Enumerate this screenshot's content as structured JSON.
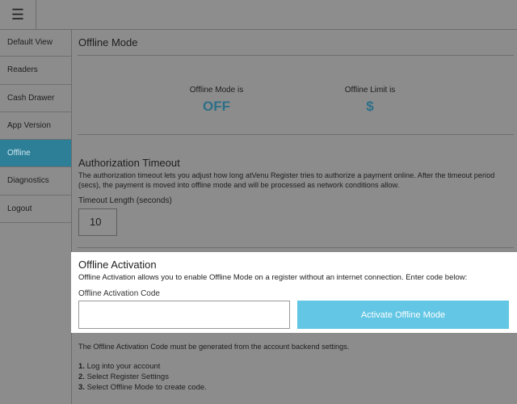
{
  "topbar": {
    "menu_icon": "hamburger-icon",
    "menu_glyph": "☰"
  },
  "sidebar": {
    "items": [
      {
        "label": "Default View"
      },
      {
        "label": "Readers"
      },
      {
        "label": "Cash Drawer"
      },
      {
        "label": "App Version"
      },
      {
        "label": "Offline",
        "active": true
      },
      {
        "label": "Diagnostics"
      },
      {
        "label": "Logout"
      }
    ]
  },
  "offline_mode": {
    "title": "Offline Mode",
    "status_label": "Offline Mode is",
    "status_value": "OFF",
    "limit_label": "Offline Limit is",
    "limit_value": "$"
  },
  "auth_timeout": {
    "title": "Authorization Timeout",
    "description": "The authorization timeout lets you adjust how long atVenu Register tries to authorize a payment online. After the timeout period (secs), the payment is moved into offline mode and will be processed as network conditions allow.",
    "field_label": "Timeout Length (seconds)",
    "value": "10"
  },
  "activation": {
    "title": "Offline Activation",
    "description": "Offline Activation allows you to enable Offline Mode on a register without an internet connection.  Enter code below:",
    "field_label": "Offline Activation Code",
    "input_value": "",
    "button_label": "Activate Offline Mode"
  },
  "instructions": {
    "note": "The Offline Activation Code must be generated from the account backend settings.",
    "steps": [
      {
        "num": "1.",
        "text": "Log into your account"
      },
      {
        "num": "2.",
        "text": "Select Register Settings"
      },
      {
        "num": "3.",
        "text": "Select Offline Mode to create code."
      }
    ]
  },
  "colors": {
    "accent": "#62c6e4",
    "active_nav": "#2d7f98",
    "status_value": "#2c6f88"
  }
}
